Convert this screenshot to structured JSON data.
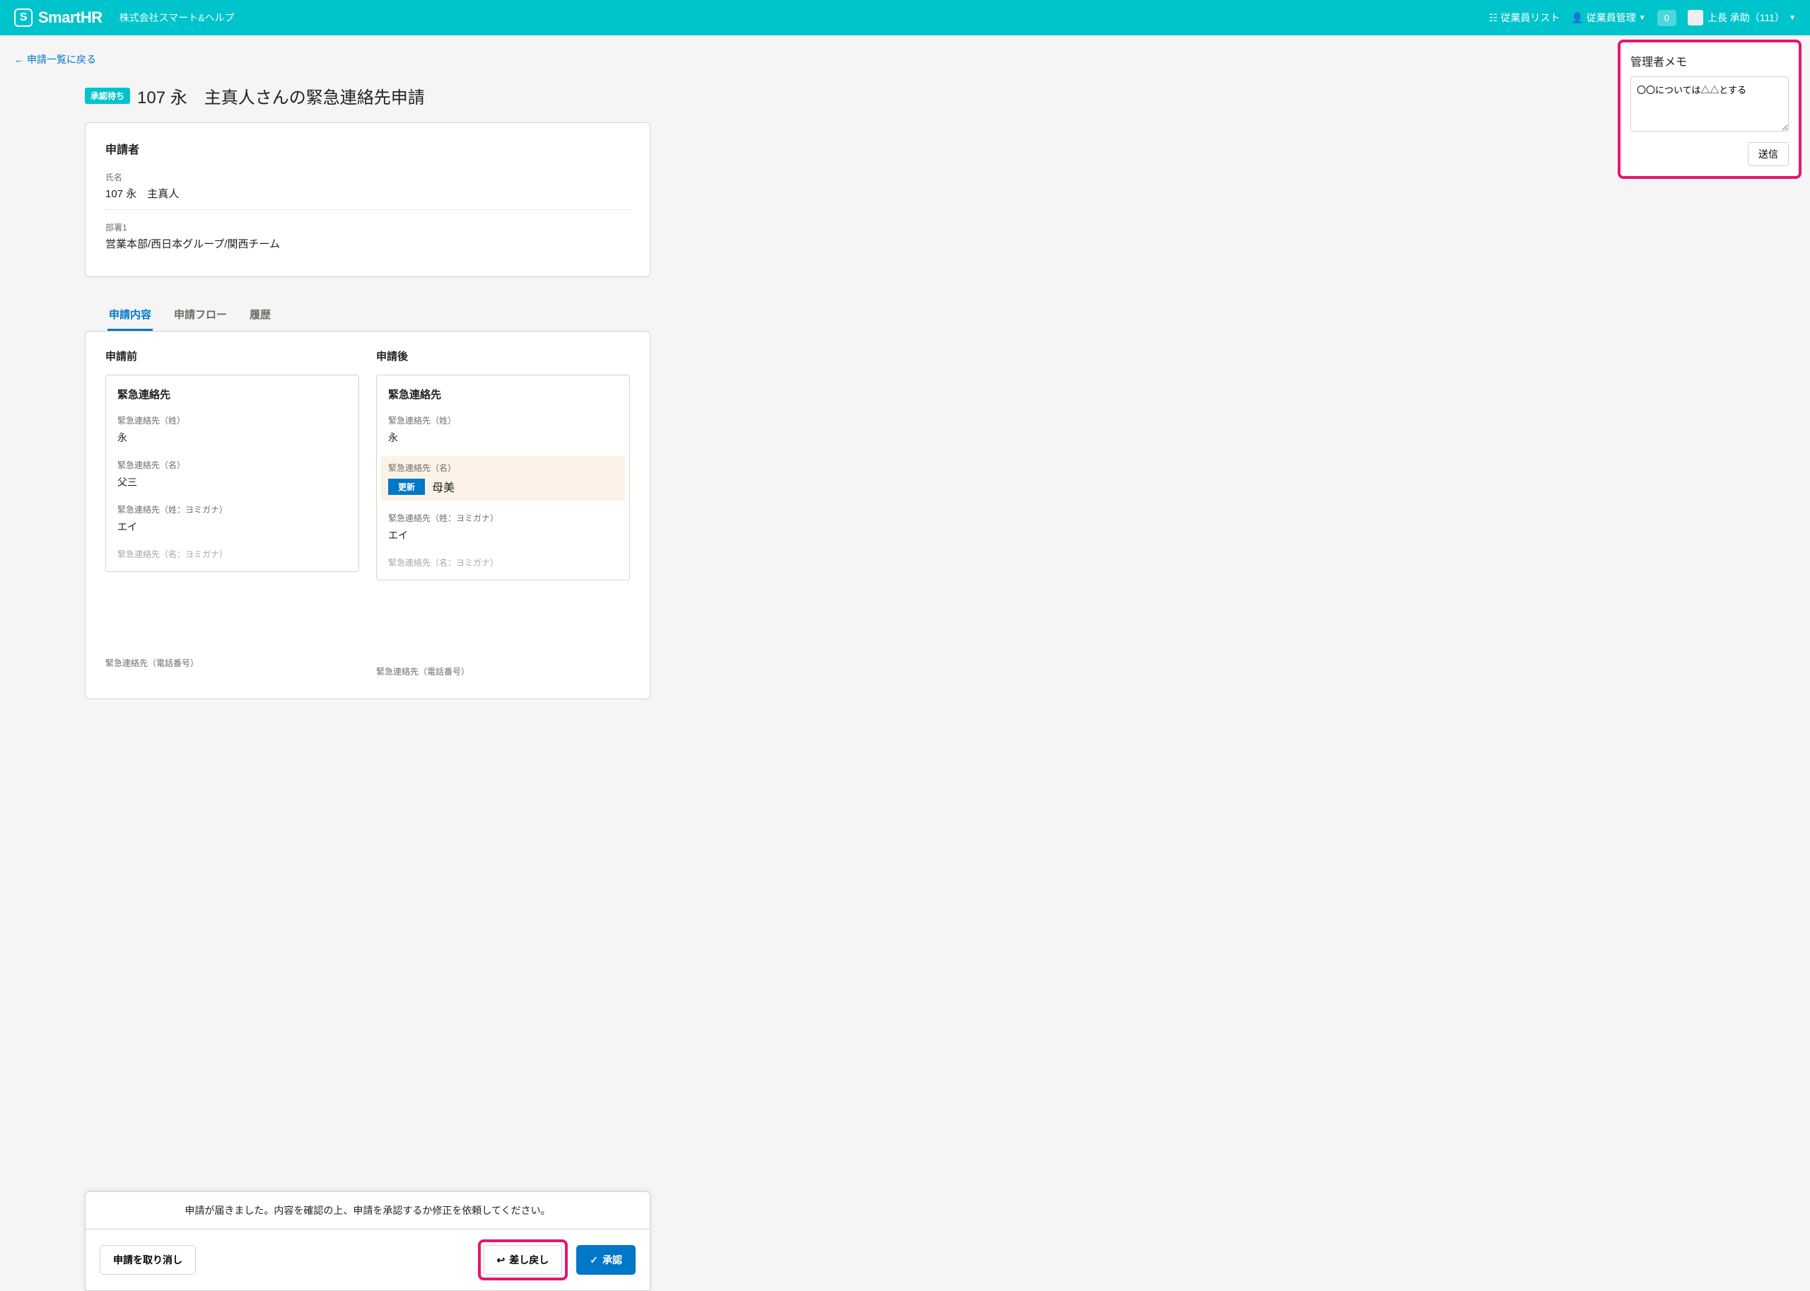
{
  "header": {
    "logo_text": "SmartHR",
    "company_name": "株式会社スマート&ヘルプ",
    "employee_list": "従業員リスト",
    "employee_mgmt": "従業員管理",
    "badge": "0",
    "user_name": "上長 承助（111）"
  },
  "back_link": "申請一覧に戻る",
  "status_badge": "承認待ち",
  "page_title": "107 永　主真人さんの緊急連絡先申請",
  "applicant": {
    "section_title": "申請者",
    "name_label": "氏名",
    "name_value": "107 永　主真人",
    "dept_label": "部署1",
    "dept_value": "営業本部/西日本グループ/関西チーム"
  },
  "tabs": [
    "申請内容",
    "申請フロー",
    "履歴"
  ],
  "application": {
    "before_label": "申請前",
    "after_label": "申請後",
    "section_title": "緊急連絡先",
    "update_badge": "更新",
    "fields": {
      "last_name_label": "緊急連絡先（姓）",
      "last_name_before": "永",
      "last_name_after": "永",
      "first_name_label": "緊急連絡先（名）",
      "first_name_before": "父三",
      "first_name_after": "母美",
      "last_kana_label": "緊急連絡先（姓：ヨミガナ）",
      "last_kana_before": "エイ",
      "last_kana_after": "エイ",
      "first_kana_label": "緊急連絡先（名：ヨミガナ）",
      "phone_label": "緊急連絡先（電話番号）"
    }
  },
  "memo": {
    "title": "管理者メモ",
    "value": "〇〇については△△とする",
    "submit": "送信"
  },
  "action_bar": {
    "message": "申請が届きました。内容を確認の上、申請を承認するか修正を依頼してください。",
    "cancel": "申請を取り消し",
    "reject": "差し戻し",
    "approve": "承認"
  }
}
